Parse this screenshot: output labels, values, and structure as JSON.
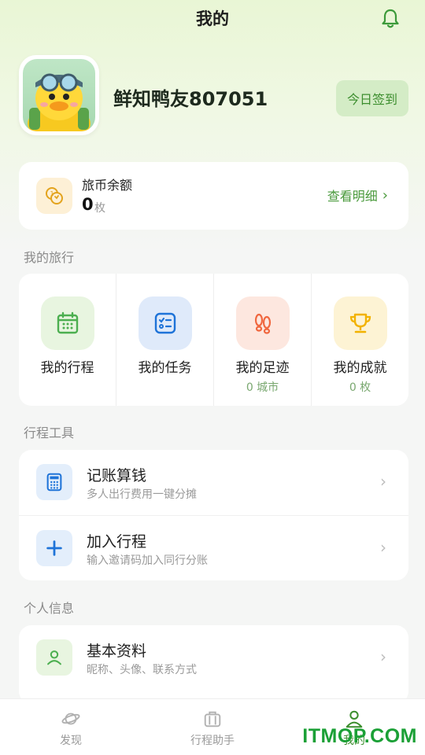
{
  "header": {
    "title": "我的",
    "bell_icon": "bell-icon"
  },
  "profile": {
    "nickname": "鲜知鸭友807051",
    "signin_label": "今日签到",
    "avatar_icon": "duck-avatar"
  },
  "coins": {
    "label": "旅币余额",
    "value": "0",
    "unit": "枚",
    "link_label": "查看明细",
    "icon": "coin-icon"
  },
  "sections": {
    "travel": "我的旅行",
    "tools": "行程工具",
    "personal": "个人信息"
  },
  "travel_items": [
    {
      "label": "我的行程",
      "sub": "",
      "icon": "calendar-icon",
      "color": "#4caf50",
      "bg": "#e8f5e0"
    },
    {
      "label": "我的任务",
      "sub": "",
      "icon": "checklist-icon",
      "color": "#1e73d8",
      "bg": "#dfeafa"
    },
    {
      "label": "我的足迹",
      "sub": "0 城市",
      "icon": "footprints-icon",
      "color": "#f0673f",
      "bg": "#fde7df"
    },
    {
      "label": "我的成就",
      "sub": "0 枚",
      "icon": "trophy-icon",
      "color": "#f2b200",
      "bg": "#fdf3d4"
    }
  ],
  "tools": [
    {
      "title": "记账算钱",
      "sub": "多人出行费用一键分摊",
      "icon": "calculator-icon"
    },
    {
      "title": "加入行程",
      "sub": "输入邀请码加入同行分账",
      "icon": "plus-icon"
    }
  ],
  "personal": [
    {
      "title": "基本资料",
      "sub": "昵称、头像、联系方式",
      "icon": "user-icon"
    }
  ],
  "tabbar": [
    {
      "label": "发现",
      "icon": "planet-icon",
      "active": false
    },
    {
      "label": "行程助手",
      "icon": "suitcase-icon",
      "active": false
    },
    {
      "label": "我的",
      "icon": "user-icon",
      "active": true
    }
  ],
  "watermark": "ITMOP.COM",
  "colors": {
    "accent": "#3c8e2e",
    "link": "#4a9a3c",
    "tool_icon": "#1e73d8"
  }
}
